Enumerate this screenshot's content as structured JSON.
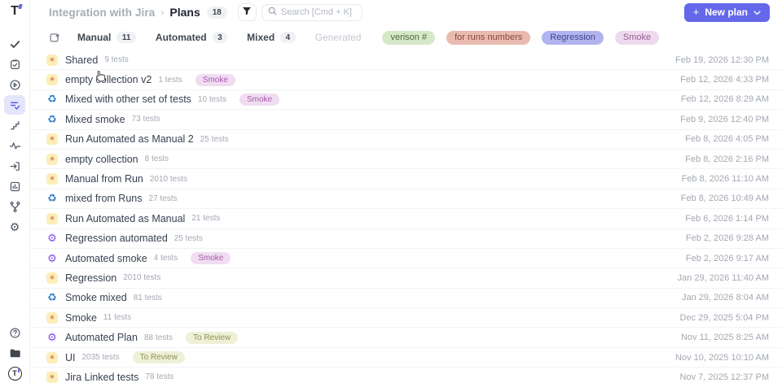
{
  "header": {
    "breadcrumb_project": "Integration with Jira",
    "breadcrumb_separator": "›",
    "breadcrumb_page": "Plans",
    "plans_count": "18",
    "search_placeholder": "Search [Cmd + K]",
    "new_plan_label": "New plan"
  },
  "colors": {
    "accent": "#6468ea",
    "manual_icon_bg": "#fdeeb9",
    "manual_icon_fg": "#bb4a22",
    "mixed_icon_fg": "#2e7cc3",
    "automated_icon_fg": "#8350e8",
    "smoke_badge_bg": "#f0ddf2",
    "smoke_badge_fg": "#a75cab",
    "to_review_badge_bg": "#eef0d8",
    "to_review_badge_fg": "#8f9352"
  },
  "sidebar": {
    "top_icons": [
      "check-icon",
      "clipboard-check-icon",
      "play-circle-icon",
      "plans-icon",
      "steps-icon",
      "pulse-icon",
      "import-icon",
      "report-chart-icon",
      "branch-icon",
      "settings-gear-icon"
    ],
    "active_icon": "plans-icon",
    "bottom_icons": [
      "help-icon",
      "folder-icon",
      "profile-avatar"
    ]
  },
  "tabs": [
    {
      "label": "Manual",
      "count": "11",
      "disabled": false
    },
    {
      "label": "Automated",
      "count": "3",
      "disabled": false
    },
    {
      "label": "Mixed",
      "count": "4",
      "disabled": false
    },
    {
      "label": "Generated",
      "count": "",
      "disabled": true
    }
  ],
  "filter_tags": [
    {
      "label": "verison #",
      "bg": "#d5e8c8",
      "fg": "#55673f"
    },
    {
      "label": "for runs numbers",
      "bg": "#e9bab0",
      "fg": "#8a4a3c"
    },
    {
      "label": "Regression",
      "bg": "#b2b4ef",
      "fg": "#42468c"
    },
    {
      "label": "Smoke",
      "bg": "#efd9ef",
      "fg": "#945f91"
    }
  ],
  "plans": [
    {
      "name": "Shared",
      "tests": "9 tests",
      "badge": "",
      "type": "manual",
      "date": "Feb 19, 2026 12:30 PM"
    },
    {
      "name": "empty collection v2",
      "tests": "1 tests",
      "badge": "Smoke",
      "type": "manual",
      "date": "Feb 12, 2026 4:33 PM"
    },
    {
      "name": "Mixed with other set of tests",
      "tests": "10 tests",
      "badge": "Smoke",
      "type": "mixed",
      "date": "Feb 12, 2026 8:29 AM"
    },
    {
      "name": "Mixed smoke",
      "tests": "73 tests",
      "badge": "",
      "type": "mixed",
      "date": "Feb 9, 2026 12:40 PM"
    },
    {
      "name": "Run Automated as Manual 2",
      "tests": "25 tests",
      "badge": "",
      "type": "manual",
      "date": "Feb 8, 2026 4:05 PM"
    },
    {
      "name": "empty collection",
      "tests": "8 tests",
      "badge": "",
      "type": "manual",
      "date": "Feb 8, 2026 2:16 PM"
    },
    {
      "name": "Manual from Run",
      "tests": "2010 tests",
      "badge": "",
      "type": "manual",
      "date": "Feb 8, 2026 11:10 AM"
    },
    {
      "name": "mixed from Runs",
      "tests": "27 tests",
      "badge": "",
      "type": "mixed",
      "date": "Feb 8, 2026 10:49 AM"
    },
    {
      "name": "Run Automated as Manual",
      "tests": "21 tests",
      "badge": "",
      "type": "manual",
      "date": "Feb 6, 2026 1:14 PM"
    },
    {
      "name": "Regression automated",
      "tests": "25 tests",
      "badge": "",
      "type": "automated",
      "date": "Feb 2, 2026 9:28 AM"
    },
    {
      "name": "Automated smoke",
      "tests": "4 tests",
      "badge": "Smoke",
      "type": "automated",
      "date": "Feb 2, 2026 9:17 AM"
    },
    {
      "name": "Regression",
      "tests": "2010 tests",
      "badge": "",
      "type": "manual",
      "date": "Jan 29, 2026 11:40 AM"
    },
    {
      "name": "Smoke mixed",
      "tests": "81 tests",
      "badge": "",
      "type": "mixed",
      "date": "Jan 29, 2026 8:04 AM"
    },
    {
      "name": "Smoke",
      "tests": "11 tests",
      "badge": "",
      "type": "manual",
      "date": "Dec 29, 2025 5:04 PM"
    },
    {
      "name": "Automated Plan",
      "tests": "88 tests",
      "badge": "To Review",
      "type": "automated",
      "date": "Nov 11, 2025 8:25 AM"
    },
    {
      "name": "UI",
      "tests": "2035 tests",
      "badge": "To Review",
      "type": "manual",
      "date": "Nov 10, 2025 10:10 AM"
    },
    {
      "name": "Jira Linked tests",
      "tests": "78 tests",
      "badge": "",
      "type": "manual",
      "date": "Nov 7, 2025 12:37 PM"
    }
  ]
}
